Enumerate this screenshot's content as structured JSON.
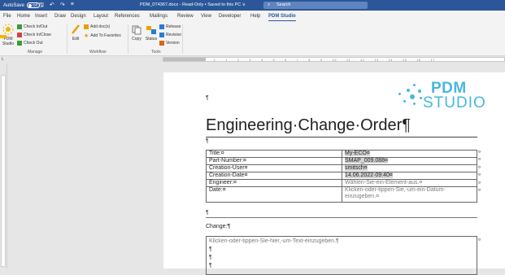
{
  "titlebar": {
    "autosave_label": "AutoSave",
    "autosave_state": "Off",
    "doc_title": "PDM_0T4367.docx  -  Read-Only  •  Saved to this PC ∨",
    "search_placeholder": "Search"
  },
  "tabs": [
    "File",
    "Home",
    "Insert",
    "Draw",
    "Design",
    "Layout",
    "References",
    "Mailings",
    "Review",
    "View",
    "Developer",
    "Help",
    "PDM Studio"
  ],
  "active_tab": "PDM Studio",
  "ribbon": {
    "pdm_studio_btn": "PDM Studio",
    "check_in_out": "Check In/Out",
    "check_in_close": "Check In/Close",
    "check_out": "Check Out",
    "add_docs": "Add doc(s)",
    "edit": "Edit",
    "add_to_favorites": "Add To Favorites",
    "copy": "Copy",
    "status": "Status",
    "release": "Release",
    "revision": "Revision",
    "version": "Version",
    "groups": {
      "manage": "Manage",
      "workflow": "Workflow",
      "tools": "Tools"
    }
  },
  "ruler_ticks": "· 1 · ⋅ · 1 · ⋅ · 2 · ⋅ · 3 · ⋅ · 4 · ⋅ · 5 · ⋅ · 6 · ⋅ · 7 · ⋅ · 8 · ⋅ · 9 · ⋅ · 10 · ⋅ · 11 · ⋅ · 12 · ⋅ · 13 · ⋅ · 14 · ⋅ · 15 · ⋅ · 16 · ⋅ · 17",
  "document": {
    "pilcrow": "¶",
    "logo_line1": "PDM",
    "logo_line2": "STUDIO",
    "heading": "Engineering·Change·Order¶",
    "fields": [
      {
        "key": "Title:¤",
        "value": "My-ECO¤"
      },
      {
        "key": "Part-Number:¤",
        "value": "SMAP_009.088¤"
      },
      {
        "key": "Creation-User¤",
        "value": "smitsch¤"
      },
      {
        "key": "Creation-Date¤",
        "value": "14.06.2022·09:40¤"
      },
      {
        "key": "Engineer:¤",
        "value": "Wählen-Sie-ein-Element-aus.¤"
      },
      {
        "key": "Date:¤",
        "value": "Klicken-oder-tippen-Sie,-um-ein-Datum-einzugeben.¤"
      }
    ],
    "cell_end": "¤",
    "change_label": "Change:¶",
    "change_placeholder": "Klicken-oder-tippen-Sie-hier,-um-Text-einzugeben.¶"
  },
  "colors": {
    "titlebar": "#2b579a",
    "logo": "#49b7de"
  }
}
